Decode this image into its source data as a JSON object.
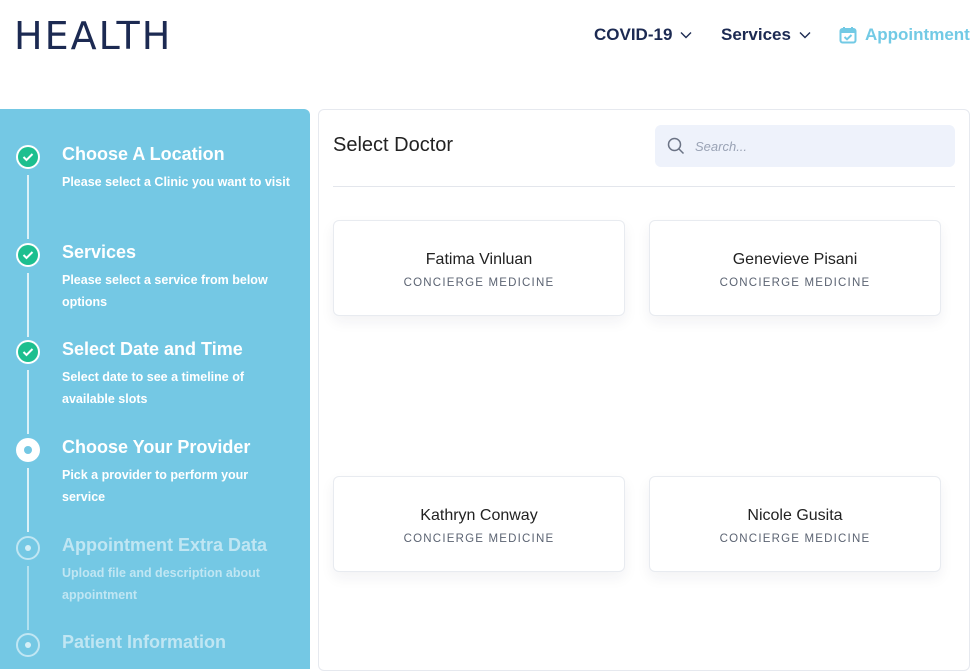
{
  "header": {
    "logo": "HEALTH",
    "nav": [
      {
        "label": "COVID-19"
      },
      {
        "label": "Services"
      },
      {
        "label": "Appointment"
      }
    ]
  },
  "sidebar": {
    "steps": [
      {
        "title": "Choose A Location",
        "desc": "Please select a Clinic you want to visit",
        "state": "done"
      },
      {
        "title": "Services",
        "desc": "Please select a service from below options",
        "state": "done"
      },
      {
        "title": "Select Date and Time",
        "desc": "Select date to see a timeline of available slots",
        "state": "done"
      },
      {
        "title": "Choose Your Provider",
        "desc": "Pick a provider to perform your service",
        "state": "current"
      },
      {
        "title": "Appointment Extra Data",
        "desc": "Upload file and description about appointment",
        "state": "pending"
      },
      {
        "title": "Patient Information",
        "desc": "",
        "state": "pending"
      }
    ]
  },
  "main": {
    "title": "Select Doctor",
    "search": {
      "placeholder": "Search...",
      "value": ""
    },
    "doctors": [
      {
        "name": "Fatima Vinluan",
        "specialty": "CONCIERGE MEDICINE"
      },
      {
        "name": "Genevieve Pisani",
        "specialty": "CONCIERGE MEDICINE"
      },
      {
        "name": "Kathryn Conway",
        "specialty": "CONCIERGE MEDICINE"
      },
      {
        "name": "Nicole Gusita",
        "specialty": "CONCIERGE MEDICINE"
      }
    ]
  },
  "colors": {
    "brand_dark": "#1c2a52",
    "accent": "#74c8e4",
    "success": "#1dbf8f"
  }
}
